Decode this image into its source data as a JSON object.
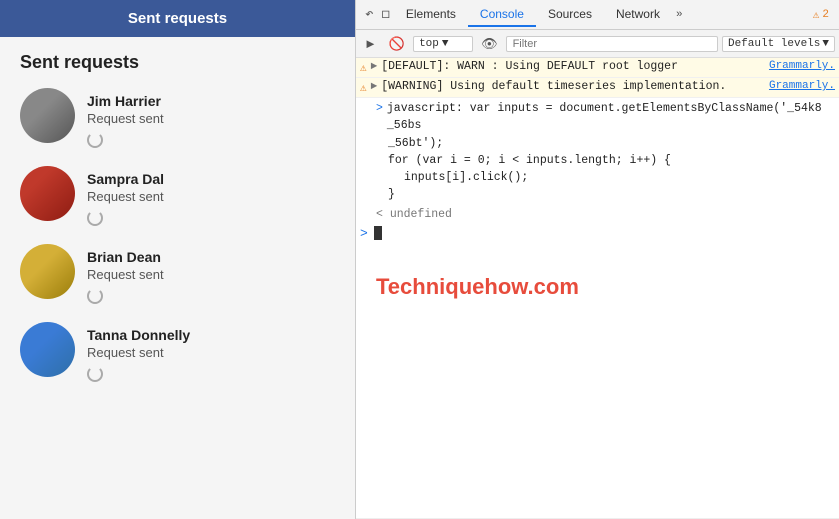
{
  "leftPanel": {
    "header": "Sent requests",
    "sectionTitle": "Sent requests",
    "items": [
      {
        "name": "Jim Harrier",
        "status": "Request sent"
      },
      {
        "name": "Sampra Dal",
        "status": "Request sent"
      },
      {
        "name": "Brian Dean",
        "status": "Request sent"
      },
      {
        "name": "Tanna Donnelly",
        "status": "Request sent"
      }
    ]
  },
  "devtools": {
    "tabs": [
      "Elements",
      "Console",
      "Sources",
      "Network",
      "»"
    ],
    "activeTab": "Console",
    "topbarIcons": [
      "cursor-icon",
      "device-icon"
    ],
    "warnCount": "2",
    "toolbar": {
      "contextLabel": "top",
      "filterPlaceholder": "Filter",
      "levelsLabel": "Default levels"
    },
    "consoleLines": [
      {
        "type": "warn",
        "icon": "▶",
        "text": "[DEFAULT]: WARN : Using DEFAULT root logger",
        "source": "Grammarly."
      },
      {
        "type": "warn",
        "icon": "▶",
        "text": "[WARNING] Using default timeseries implementation.",
        "source": "Grammarly."
      }
    ],
    "codeBlock": {
      "prompt": ">",
      "lines": [
        "javascript: var inputs = document.getElementsByClassName('_54k8 _56bs",
        "_56bt');",
        "for (var i = 0; i < inputs.length; i++) {",
        "    inputs[i].click();",
        "}"
      ]
    },
    "undefinedText": "undefined",
    "watermark": "Techniquehow.com"
  }
}
